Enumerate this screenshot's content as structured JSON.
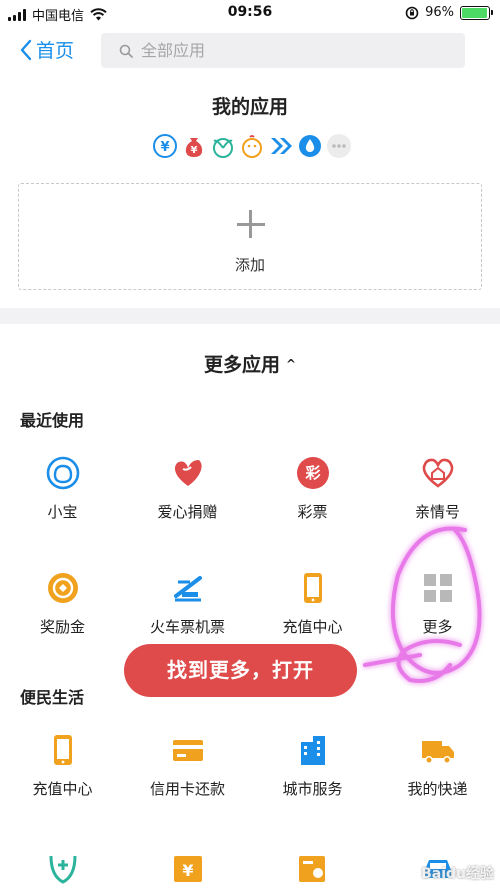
{
  "status_bar": {
    "carrier": "中国电信",
    "time": "09:56",
    "battery_percent": "96%",
    "battery_level": 0.96
  },
  "nav": {
    "back_label": "首页",
    "search_placeholder": "全部应用"
  },
  "my_apps": {
    "title": "我的应用",
    "mini_icons": [
      "yuan-circle-icon",
      "money-bag-icon",
      "leaf-sprout-icon",
      "chick-icon",
      "double-arrow-icon",
      "water-drop-icon",
      "more-dots-icon"
    ],
    "add_label": "添加"
  },
  "more_apps": {
    "title": "更多应用",
    "caret": "^"
  },
  "sections": {
    "recent": {
      "title": "最近使用",
      "row1": [
        "小宝",
        "爱心捐赠",
        "彩票",
        "亲情号"
      ],
      "row2": [
        "奖励金",
        "火车票机票",
        "充值中心",
        "更多"
      ]
    },
    "life": {
      "title": "便民生活",
      "row1": [
        "充值中心",
        "信用卡还款",
        "城市服务",
        "我的快递"
      ]
    }
  },
  "caipiao_char": "彩",
  "tooltip": "找到更多，打开",
  "watermark": "Baidu经验",
  "colors": {
    "blue": "#1a8ee8",
    "red": "#df4a4a",
    "orange": "#f0a21f",
    "teal": "#2bb49b"
  }
}
